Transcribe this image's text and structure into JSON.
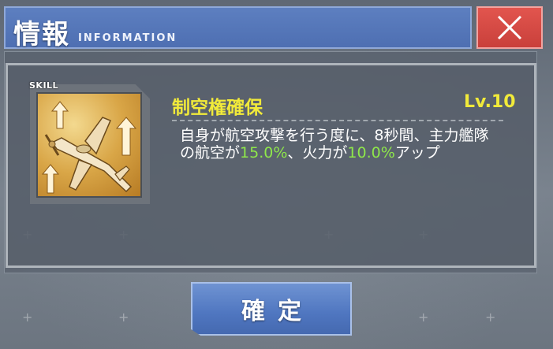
{
  "header": {
    "title": "情報",
    "subtitle": "INFORMATION"
  },
  "close_icon": "close-icon",
  "skill": {
    "tag": "SKILL",
    "name": "制空権確保",
    "level": "Lv.10",
    "icon": "airplane-arrows-icon",
    "description": {
      "part1": "自身が航空攻撃を行う度に、8秒間、主力艦隊の航空が",
      "value1": "15.0%",
      "part2": "、火力が",
      "value2": "10.0%",
      "part3": "アップ"
    }
  },
  "confirm": {
    "label": "確定"
  },
  "colors": {
    "header": "#4e6fb2",
    "close": "#c9403b",
    "skill_name": "#f1ea3a",
    "highlight": "#8fe84a",
    "confirm": "#4f76c0"
  }
}
